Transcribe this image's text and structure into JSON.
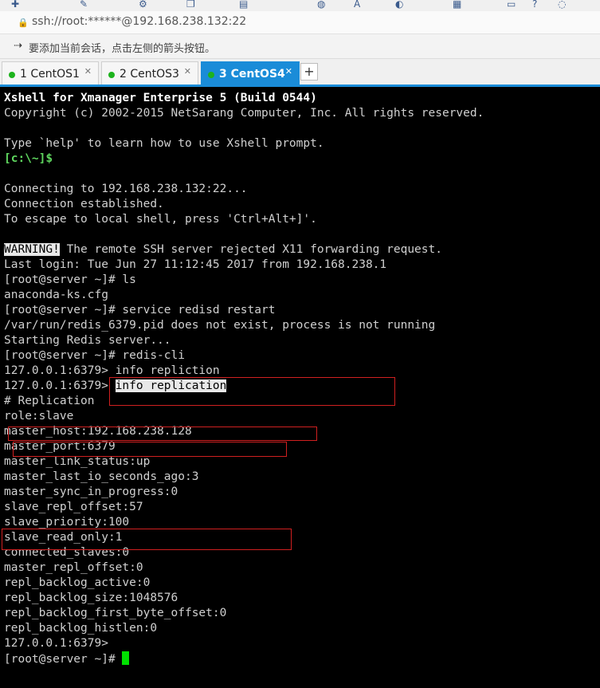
{
  "toolbar": {
    "icons": [
      "new-session-icon",
      "properties-icon",
      "transfer-icon",
      "globe-icon",
      "font-icon",
      "color-icon",
      "layout-icon",
      "help-icon",
      "chat-icon"
    ]
  },
  "address": {
    "url": "ssh://root:******@192.168.238.132:22"
  },
  "hint": {
    "text": "要添加当前会话，点击左侧的箭头按钮。"
  },
  "tabs": [
    {
      "label": "1 CentOS1",
      "active": false
    },
    {
      "label": "2 CentOS3",
      "active": false
    },
    {
      "label": "3 CentOS4",
      "active": true
    }
  ],
  "tab_add_label": "+",
  "terminal": {
    "lines": [
      "Xshell for Xmanager Enterprise 5 (Build 0544)",
      "Copyright (c) 2002-2015 NetSarang Computer, Inc. All rights reserved.",
      "",
      "Type `help' to learn how to use Xshell prompt.",
      "[c:\\~]$",
      "",
      "Connecting to 192.168.238.132:22...",
      "Connection established.",
      "To escape to local shell, press 'Ctrl+Alt+]'.",
      "",
      "WARNING!",
      " The remote SSH server rejected X11 forwarding request.",
      "Last login: Tue Jun 27 11:12:45 2017 from 192.168.238.1",
      "[root@server ~]# ls",
      "anaconda-ks.cfg",
      "[root@server ~]# service redisd restart",
      "/var/run/redis_6379.pid does not exist, process is not running",
      "Starting Redis server...",
      "[root@server ~]# redis-cli",
      "127.0.0.1:6379> info repliction",
      "127.0.0.1:6379> ",
      "info replication",
      "# Replication",
      "role:slave",
      "master_host:192.168.238.128",
      "master_port:6379",
      "master_link_status:up",
      "master_last_io_seconds_ago:3",
      "master_sync_in_progress:0",
      "slave_repl_offset:57",
      "slave_priority:100",
      "slave_read_only:1",
      "connected_slaves:0",
      "master_repl_offset:0",
      "repl_backlog_active:0",
      "repl_backlog_size:1048576",
      "repl_backlog_first_byte_offset:0",
      "repl_backlog_histlen:0",
      "127.0.0.1:6379>",
      "[root@server ~]# "
    ]
  }
}
